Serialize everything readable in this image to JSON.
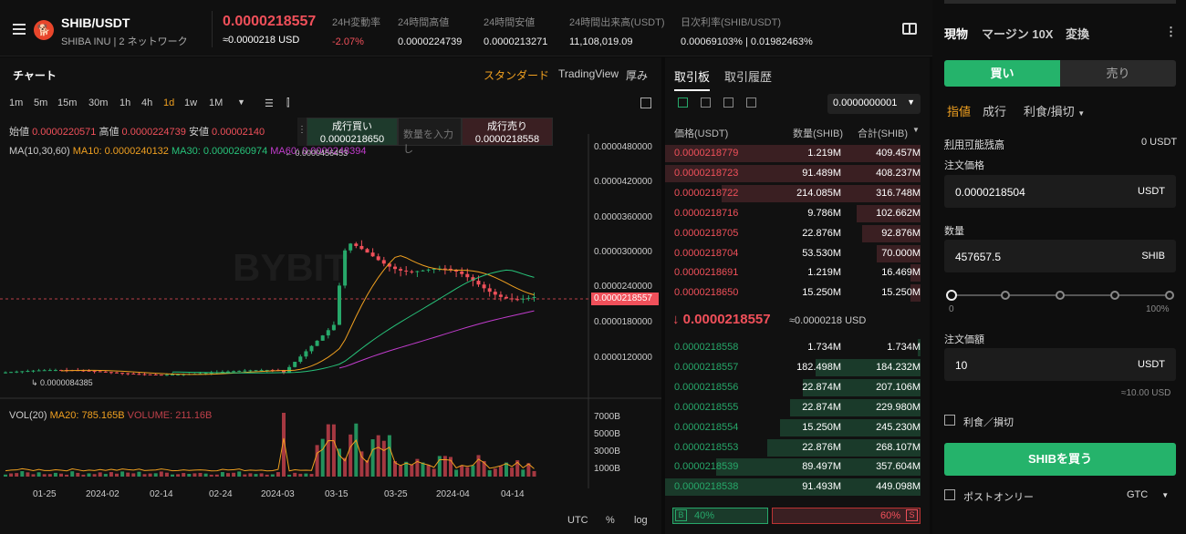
{
  "header": {
    "pair": "SHIB/USDT",
    "coin_name": "SHIBA INU",
    "network": "2 ネットワーク",
    "price": "0.0000218557",
    "price_sub": "≈0.0000218 USD",
    "stats": [
      {
        "label": "24H変動率",
        "value": "-2.07%"
      },
      {
        "label": "24時間高値",
        "value": "0.0000224739"
      },
      {
        "label": "24時間安値",
        "value": "0.0000213271"
      },
      {
        "label": "24時間出来高(USDT)",
        "value": "11,108,019.09"
      },
      {
        "label": "日次利率(SHIB/USDT)",
        "value": "0.00069103% | 0.01982463%"
      }
    ]
  },
  "chart": {
    "title": "チャート",
    "options": [
      "スタンダード",
      "TradingView",
      "厚み"
    ],
    "timeframes": [
      "1m",
      "5m",
      "15m",
      "30m",
      "1h",
      "4h",
      "1d",
      "1w",
      "1M"
    ],
    "active_tf": "1d",
    "ohlc": {
      "open_l": "始値",
      "open": "0.0000220571",
      "high_l": "高値",
      "high": "0.0000224739",
      "low_l": "安値",
      "low": "0.00002140"
    },
    "ma": {
      "label": "MA(10,30,60)",
      "ma10": "MA10: 0.0000240132",
      "ma30": "MA30: 0.0000260974",
      "ma60": "MA60: 0.0000248394"
    },
    "market": {
      "buy_l": "成行買い",
      "buy": "0.0000218650",
      "qty_ph": "数量を入力し",
      "sell_l": "成行売り",
      "sell": "0.0000218558"
    },
    "max_label": "0.0000456453",
    "min_label": "0.0000084385",
    "current": "0.0000218557",
    "ylabels": [
      "0.0000480000",
      "0.0000420000",
      "0.0000360000",
      "0.0000300000",
      "0.0000240000",
      "0.0000180000",
      "0.0000120000"
    ],
    "vol": {
      "label": "VOL(20)",
      "ma20": "MA20: 785.165B",
      "volume": "VOLUME: 211.16B"
    },
    "vlabels": [
      "7000B",
      "5000B",
      "3000B",
      "1000B"
    ],
    "xlabels": [
      "01-25",
      "2024-02",
      "02-14",
      "02-24",
      "2024-03",
      "03-15",
      "03-25",
      "2024-04",
      "04-14"
    ],
    "footer": [
      "UTC",
      "%",
      "log"
    ],
    "watermark": "BYBIT"
  },
  "orderbook": {
    "tabs": [
      "取引板",
      "取引履歴"
    ],
    "precision": "0.0000000001",
    "headers": [
      "価格(USDT)",
      "数量(SHIB)",
      "合計(SHIB)"
    ],
    "asks": [
      [
        "0.0000218779",
        "1.219M",
        "409.457M",
        100
      ],
      [
        "0.0000218723",
        "91.489M",
        "408.237M",
        100
      ],
      [
        "0.0000218722",
        "214.085M",
        "316.748M",
        78
      ],
      [
        "0.0000218716",
        "9.786M",
        "102.662M",
        25
      ],
      [
        "0.0000218705",
        "22.876M",
        "92.876M",
        23
      ],
      [
        "0.0000218704",
        "53.530M",
        "70.000M",
        17
      ],
      [
        "0.0000218691",
        "1.219M",
        "16.469M",
        4
      ],
      [
        "0.0000218650",
        "15.250M",
        "15.250M",
        4
      ]
    ],
    "mid_price": "0.0000218557",
    "mid_usd": "≈0.0000218 USD",
    "bids": [
      [
        "0.0000218558",
        "1.734M",
        "1.734M",
        1
      ],
      [
        "0.0000218557",
        "182.498M",
        "184.232M",
        41
      ],
      [
        "0.0000218556",
        "22.874M",
        "207.106M",
        46
      ],
      [
        "0.0000218555",
        "22.874M",
        "229.980M",
        51
      ],
      [
        "0.0000218554",
        "15.250M",
        "245.230M",
        55
      ],
      [
        "0.0000218553",
        "22.876M",
        "268.107M",
        60
      ],
      [
        "0.0000218539",
        "89.497M",
        "357.604M",
        80
      ],
      [
        "0.0000218538",
        "91.493M",
        "449.098M",
        100
      ]
    ],
    "buy_ratio": "40%",
    "sell_ratio": "60%",
    "b": "B",
    "s": "S"
  },
  "trade": {
    "tabs": [
      "現物",
      "マージン 10X",
      "変換"
    ],
    "buy": "買い",
    "sell": "売り",
    "order_types": [
      "指値",
      "成行",
      "利食/損切"
    ],
    "available_l": "利用可能残高",
    "available": "0 USDT",
    "price_l": "注文価格",
    "price": "0.0000218504",
    "price_u": "USDT",
    "qty_l": "数量",
    "qty": "457657.5",
    "qty_u": "SHIB",
    "pct_min": "0",
    "pct_max": "100%",
    "value_l": "注文価額",
    "value": "10",
    "value_u": "USDT",
    "value_sub": "≈10.00 USD",
    "tpsl": "利食／損切",
    "button": "SHIBを買う",
    "post_only": "ポストオンリー",
    "tif": "GTC"
  },
  "colors": {
    "up": "#27a86a",
    "down": "#f0505a",
    "accent": "#f0a020"
  }
}
